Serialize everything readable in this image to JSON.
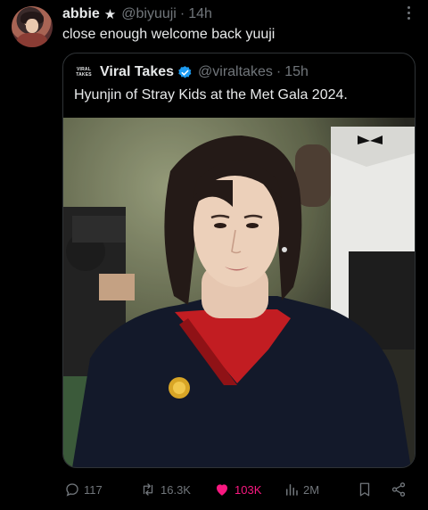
{
  "tweet": {
    "display_name": "abbie",
    "name_symbol": "★",
    "handle": "@biyuuji",
    "separator": "·",
    "time": "14h",
    "text": "close enough welcome back yuuji"
  },
  "quoted": {
    "logo_text_line1": "VIRAL",
    "logo_text_line2": "TAKES",
    "display_name": "Viral Takes",
    "handle": "@viraltakes",
    "separator": "·",
    "time": "15h",
    "text": "Hyunjin of Stray Kids at the Met Gala 2024."
  },
  "actions": {
    "replies": "117",
    "reposts": "16.3K",
    "likes": "103K",
    "views": "2M"
  },
  "colors": {
    "background": "#000000",
    "text": "#e7e9ea",
    "muted": "#71767b",
    "like": "#f91880",
    "verified": "#1d9bf0",
    "border": "#2f3336"
  },
  "icons": [
    "more-icon",
    "verified-icon",
    "reply-icon",
    "repost-icon",
    "like-icon",
    "views-icon",
    "bookmark-icon",
    "share-icon"
  ]
}
